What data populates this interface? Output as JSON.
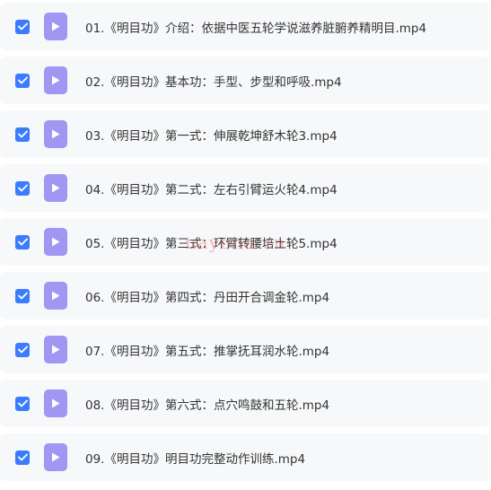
{
  "files": [
    {
      "name": "01.《明目功》介绍：依据中医五轮学说滋养脏腑养精明目.mp4",
      "checked": true
    },
    {
      "name": "02.《明目功》基本功：手型、步型和呼吸.mp4",
      "checked": true
    },
    {
      "name": "03.《明目功》第一式：伸展乾坤舒木轮3.mp4",
      "checked": true
    },
    {
      "name": "04.《明目功》第二式：左右引臂运火轮4.mp4",
      "checked": true
    },
    {
      "name": "05.《明目功》第三式：环臂转腰培土轮5.mp4",
      "checked": true
    },
    {
      "name": "06.《明目功》第四式：丹田开合调金轮.mp4",
      "checked": true
    },
    {
      "name": "07.《明目功》第五式：推掌抚耳润水轮.mp4",
      "checked": true
    },
    {
      "name": "08.《明目功》第六式：点穴鸣鼓和五轮.mp4",
      "checked": true
    },
    {
      "name": "09.《明目功》明目功完整动作训练.mp4",
      "checked": true
    }
  ],
  "watermark": "nayona.cn",
  "colors": {
    "checkbox": "#3b7cff",
    "video_icon": "#a196f2",
    "row_background": "#f7f8fa",
    "text": "#333333"
  },
  "icons": {
    "checkbox": "checkmark-icon",
    "file": "video-file-icon"
  }
}
